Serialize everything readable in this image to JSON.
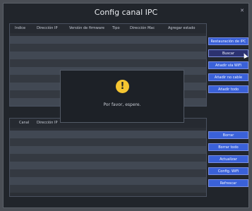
{
  "window": {
    "title": "Config canal IPC"
  },
  "top_table": {
    "headers": [
      "Indice",
      "Dirección IP",
      "Versión de firmware",
      "Tipo",
      "Dirección Mac",
      "Agregar estado"
    ]
  },
  "bottom_table": {
    "headers": [
      "Canal",
      "Dirección IP"
    ]
  },
  "buttons_top": [
    "Restauración de IPC",
    "Buscar",
    "Añadir vía WiFi",
    "Añadir no cable",
    "Añadir todo"
  ],
  "buttons_bottom": [
    "Borrar",
    "Borrar todo",
    "Actualizar",
    "Config. WiFi",
    "Refrescar"
  ],
  "modal": {
    "icon": "!",
    "message": "Por favor, espere."
  },
  "colors": {
    "accent": "#3a61d8",
    "warning": "#f5c531",
    "background": "#21252b"
  }
}
